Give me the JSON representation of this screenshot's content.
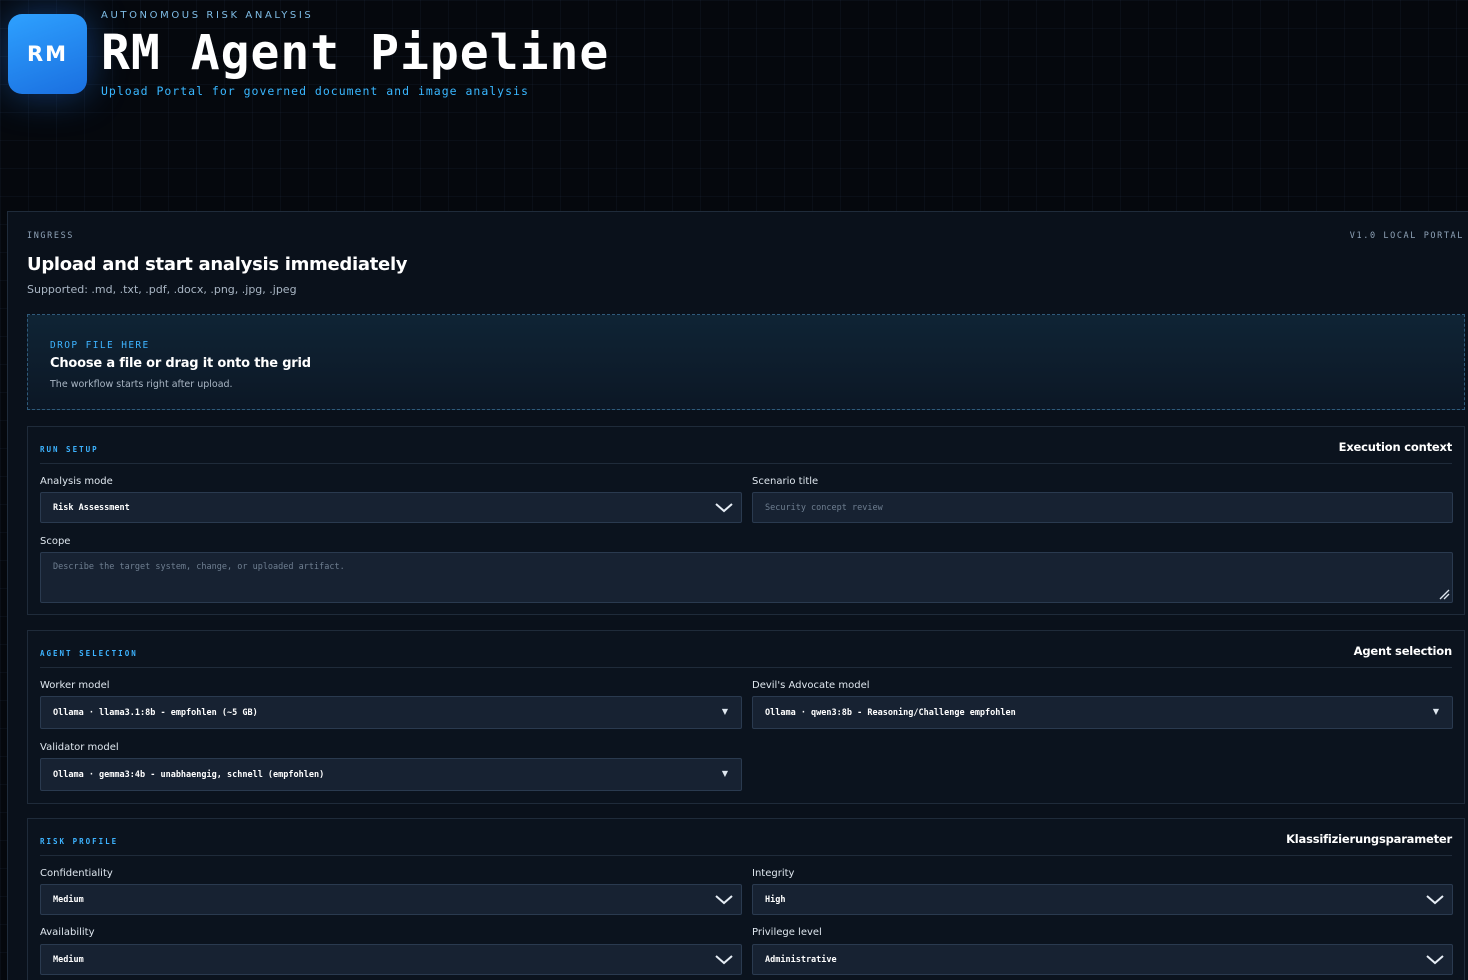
{
  "header": {
    "logo_text": "RM",
    "eyebrow": "AUTONOMOUS RISK ANALYSIS",
    "title": "RM Agent Pipeline",
    "subtitle": "Upload Portal for governed document and image analysis"
  },
  "panel": {
    "label": "INGRESS",
    "version": "V1.0 LOCAL PORTAL",
    "heading": "Upload and start analysis immediately",
    "supported": "Supported: .md, .txt, .pdf, .docx, .png, .jpg, .jpeg"
  },
  "dropzone": {
    "label": "DROP FILE HERE",
    "title": "Choose a file or drag it onto the grid",
    "hint": "The workflow starts right after upload."
  },
  "run_setup": {
    "section_label": "RUN SETUP",
    "section_title": "Execution context",
    "analysis_mode": {
      "label": "Analysis mode",
      "value": "Risk Assessment"
    },
    "scenario_title": {
      "label": "Scenario title",
      "placeholder": "Security concept review",
      "value": ""
    },
    "scope": {
      "label": "Scope",
      "placeholder": "Describe the target system, change, or uploaded artifact.",
      "value": ""
    }
  },
  "agent_selection": {
    "section_label": "AGENT SELECTION",
    "section_title": "Agent selection",
    "worker_model": {
      "label": "Worker model",
      "value": "Ollama · llama3.1:8b - empfohlen (~5 GB)"
    },
    "devils_advocate_model": {
      "label": "Devil's Advocate model",
      "value": "Ollama · qwen3:8b - Reasoning/Challenge empfohlen"
    },
    "validator_model": {
      "label": "Validator model",
      "value": "Ollama · gemma3:4b - unabhaengig, schnell (empfohlen)"
    }
  },
  "risk_profile": {
    "section_label": "RISK PROFILE",
    "section_title": "Klassifizierungsparameter",
    "confidentiality": {
      "label": "Confidentiality",
      "value": "Medium"
    },
    "integrity": {
      "label": "Integrity",
      "value": "High"
    },
    "availability": {
      "label": "Availability",
      "value": "Medium"
    },
    "privilege_level": {
      "label": "Privilege level",
      "value": "Administrative"
    }
  },
  "icons": {
    "select_chevron": "chevron-down-icon",
    "native_select_arrow": "triangle-down-icon",
    "textarea_resize": "resize-grip-icon"
  },
  "colors": {
    "background": "#05080d",
    "accent": "#3db3ff",
    "logo_gradient_start": "#2ea1ff",
    "logo_gradient_end": "#1a6fe0",
    "control_bg": "#172232"
  }
}
